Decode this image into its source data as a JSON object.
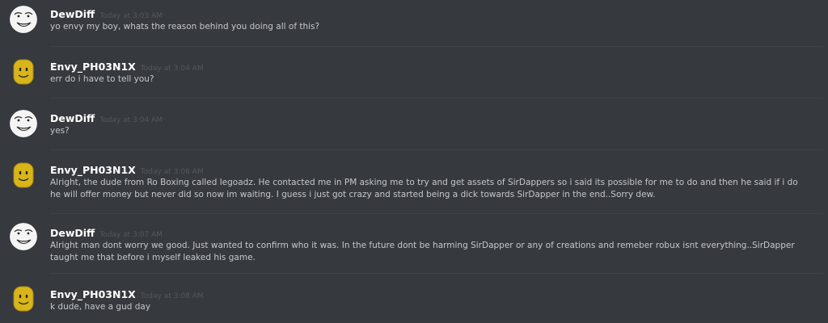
{
  "messages": [
    {
      "author": "DewDiff",
      "avatar": "meme-face-avatar",
      "timestamp": "Today at 3:03 AM",
      "text": "yo envy my boy, whats the reason behind you doing all of this?"
    },
    {
      "author": "Envy_PH03N1X",
      "avatar": "yellow-block-avatar",
      "timestamp": "Today at 3:04 AM",
      "text": "err do i have to tell you?"
    },
    {
      "author": "DewDiff",
      "avatar": "meme-face-avatar",
      "timestamp": "Today at 3:04 AM",
      "text": "yes?"
    },
    {
      "author": "Envy_PH03N1X",
      "avatar": "yellow-block-avatar",
      "timestamp": "Today at 3:06 AM",
      "text": "Alright, the dude from Ro Boxing called legoadz. He contacted me in PM asking me to try and get assets of SirDappers so i said its possible for me to do and then he said if i do he will offer money but never did so now im waiting. I guess i just got crazy and started being a dick towards SirDapper in the end..Sorry dew."
    },
    {
      "author": "DewDiff",
      "avatar": "meme-face-avatar",
      "timestamp": "Today at 3:07 AM",
      "text": "Alright man dont worry we good. Just wanted to confirm who it was. In the future dont be harming SirDapper or any of creations and remeber robux isnt everything..SirDapper taught me that before i myself leaked his game."
    },
    {
      "author": "Envy_PH03N1X",
      "avatar": "yellow-block-avatar",
      "timestamp": "Today at 3:08 AM",
      "text": "k dude, have a gud day"
    }
  ],
  "colors": {
    "background": "#36393e",
    "author": "#ffffff",
    "timestamp": "#54575c",
    "text": "#c6c8ca",
    "divider": "#3f4248"
  }
}
